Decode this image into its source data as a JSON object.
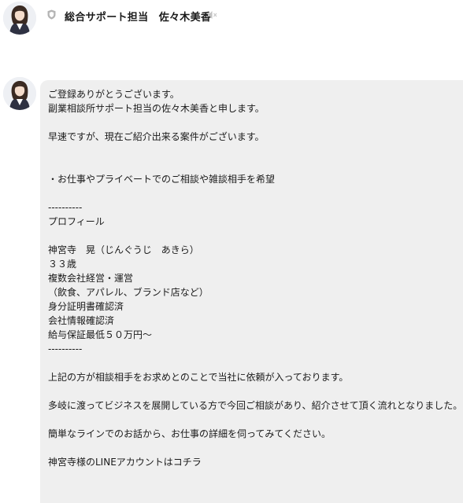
{
  "header": {
    "sender_name": "総合サポート担当　佐々木美香"
  },
  "message": {
    "lines": [
      "ご登録ありがとうございます。",
      "副業相談所サポート担当の佐々木美香と申します。",
      "",
      "早速ですが、現在ご紹介出来る案件がございます。",
      "",
      "",
      "・お仕事やプライベートでのご相談や雑談相手を希望",
      "",
      "----------",
      "プロフィール",
      "",
      "神宮寺　晃（じんぐうじ　あきら）",
      "３３歳",
      "複数会社経営・運営",
      "（飲食、アパレル、ブランド店など）",
      "身分証明書確認済",
      "会社情報確認済",
      "給与保証最低５０万円～",
      "----------",
      "",
      "上記の方が相談相手をお求めとのことで当社に依頼が入っております。",
      "",
      "多岐に渡ってビジネスを展開している方で今回ご相談があり、紹介させて頂く流れとなりました。",
      "",
      "簡単なラインでのお話から、お仕事の詳細を伺ってみてください。",
      "",
      "神宮寺様のLINEアカウントはコチラ"
    ]
  },
  "colors": {
    "bubble_background": "#efefef",
    "text": "#1a1a1a",
    "icon_gray": "#b4b4b4"
  },
  "icons": {
    "shield": "shield-icon",
    "mute": "speaker-mute-icon"
  }
}
